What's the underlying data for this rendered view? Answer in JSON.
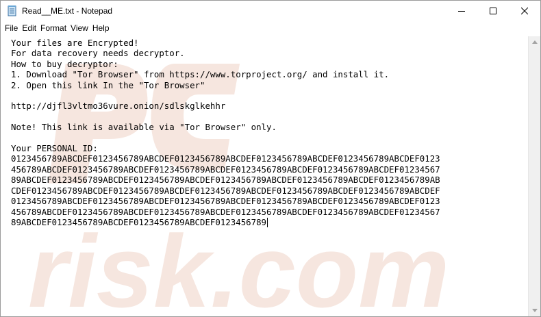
{
  "window": {
    "title": "Read__ME.txt - Notepad",
    "controls": {
      "minimize_icon": "minimize-icon",
      "maximize_icon": "maximize-icon",
      "close_icon": "close-icon"
    }
  },
  "menu": {
    "file": "File",
    "edit": "Edit",
    "format": "Format",
    "view": "View",
    "help": "Help"
  },
  "document": {
    "lines": [
      "Your files are Encrypted!",
      "For data recovery needs decryptor.",
      "How to buy decryptor:",
      "1. Download \"Tor Browser\" from https://www.torproject.org/ and install it.",
      "2. Open this link In the \"Tor Browser\"",
      "",
      "http://djfl3vltmo36vure.onion/sdlskglkehhr",
      "",
      "Note! This link is available via \"Tor Browser\" only.",
      "",
      "Your PERSONAL ID:",
      "0123456789ABCDEF0123456789ABCDEF0123456789ABCDEF0123456789ABCDEF0123456789ABCDEF0123",
      "456789ABCDEF0123456789ABCDEF0123456789ABCDEF0123456789ABCDEF0123456789ABCDEF01234567",
      "89ABCDEF0123456789ABCDEF0123456789ABCDEF0123456789ABCDEF0123456789ABCDEF0123456789AB",
      "CDEF0123456789ABCDEF0123456789ABCDEF0123456789ABCDEF0123456789ABCDEF0123456789ABCDEF",
      "0123456789ABCDEF0123456789ABCDEF0123456789ABCDEF0123456789ABCDEF0123456789ABCDEF0123",
      "456789ABCDEF0123456789ABCDEF0123456789ABCDEF0123456789ABCDEF0123456789ABCDEF01234567",
      "89ABCDEF0123456789ABCDEF0123456789ABCDEF0123456789"
    ]
  },
  "watermark": {
    "text": "risk.com",
    "color": "#f6e6df"
  }
}
